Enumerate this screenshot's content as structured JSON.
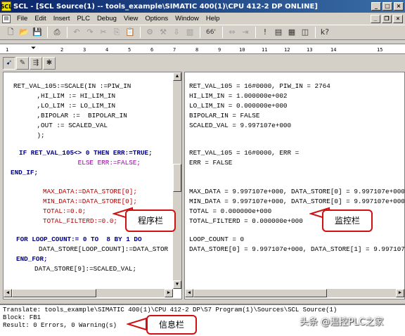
{
  "window": {
    "title": "SCL - [SCL Source(1) -- tools_example\\SIMATIC 400(1)\\CPU 412-2 DP  ONLINE]",
    "app_icon": "SCL"
  },
  "menubar": {
    "items": [
      "File",
      "Edit",
      "Insert",
      "PLC",
      "Debug",
      "View",
      "Options",
      "Window",
      "Help"
    ]
  },
  "toolbar": {
    "zoom_label": "66'",
    "help_label": "k?"
  },
  "ruler": {
    "marks": [
      "1",
      "2",
      "3",
      "4",
      "5",
      "6",
      "7",
      "8",
      "9",
      "10",
      "11",
      "12",
      "13",
      "14",
      "15"
    ]
  },
  "program_pane": {
    "lines": [
      "RET_VAL_105:=SCALE(IN :=PIW_IN",
      "      ,HI_LIM := HI_LIM_IN",
      "      ,LO_LIM := LO_LIM_IN",
      "      ,BIPOLAR :=  BIPOLAR_IN",
      "      ,OUT := SCALED_VAL",
      "      );",
      "IF RET_VAL_105<> 0 THEN ERR:=TRUE;",
      "               ELSE ERR:=FALSE;",
      "END_IF;",
      "MAX_DATA:=DATA_STORE[0];",
      "MIN_DATA:=DATA_STORE[0];",
      "TOTAL:=0.0;",
      "TOTAL_FILTERD:=0.0;",
      "FOR LOOP_COUNT:= 0 TO  8 BY 1 DO",
      "DATA_STORE[LOOP_COUNT]:=DATA_STOR",
      "END_FOR;",
      "DATA_STORE[9]:=SCALED_VAL;"
    ]
  },
  "monitor_pane": {
    "lines": [
      "RET_VAL_105 = 16#0000, PIW_IN = 2764",
      "HI_LIM_IN = 1.000000e+002",
      "LO_LIM_IN = 0.000000e+000",
      "BIPOLAR_IN = FALSE",
      "SCALED_VAL = 9.997107e+000",
      "RET_VAL_105 = 16#0000, ERR =",
      "ERR = FALSE",
      "MAX_DATA = 9.997107e+000, DATA_STORE[0] = 9.997107e+000",
      "MIN_DATA = 9.997107e+000, DATA_STORE[0] = 9.997107e+000",
      "TOTAL = 0.000000e+000",
      "TOTAL_FILTERD = 0.000000e+000",
      "LOOP_COUNT = 0",
      "DATA_STORE[0] = 9.997107e+000, DATA_STORE[1] = 9.997107e"
    ]
  },
  "callouts": {
    "program": "程序栏",
    "monitor": "监控栏",
    "info": "信息栏"
  },
  "message_pane": {
    "lines": [
      "Translate: tools_example\\SIMATIC 400(1)\\CPU 412-2 DP\\S7 Program(1)\\Sources\\SCL Source(1)",
      "Block: FB1",
      "Result: 0 Errors, 0 Warning(s)"
    ]
  },
  "watermark": "头条 @温控PLC之家"
}
